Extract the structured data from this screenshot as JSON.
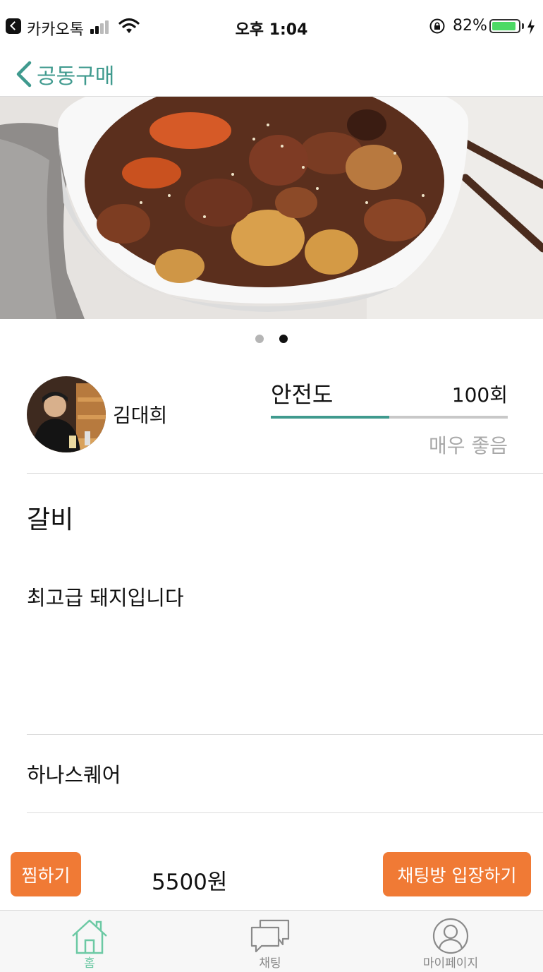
{
  "status_bar": {
    "app_name": "카카오톡",
    "time": "오후 1:04",
    "battery": "82%",
    "battery_level": 0.82
  },
  "nav": {
    "back_label": "공동구매"
  },
  "carousel": {
    "image_icon": "braised-short-ribs-photo",
    "page_count": 2,
    "active_index": 1
  },
  "seller": {
    "name": "김대희",
    "avatar_icon": "person-photo"
  },
  "safety": {
    "label": "안전도",
    "count": "100회",
    "grade": "매우 좋음",
    "level": 0.5,
    "accent_color": "#3f9a8e"
  },
  "item": {
    "title": "갈비",
    "description": "최고급 돼지입니다",
    "location": "하나스퀘어"
  },
  "actions": {
    "favorite_label": "찜하기",
    "price": "5500원",
    "enter_chat_label": "채팅방 입장하기",
    "button_color": "#f07a35"
  },
  "tab_bar": {
    "tabs": [
      {
        "label": "홈",
        "icon": "home-icon",
        "active": true
      },
      {
        "label": "채팅",
        "icon": "chat-icon",
        "active": false
      },
      {
        "label": "마이페이지",
        "icon": "person-icon",
        "active": false
      }
    ]
  }
}
